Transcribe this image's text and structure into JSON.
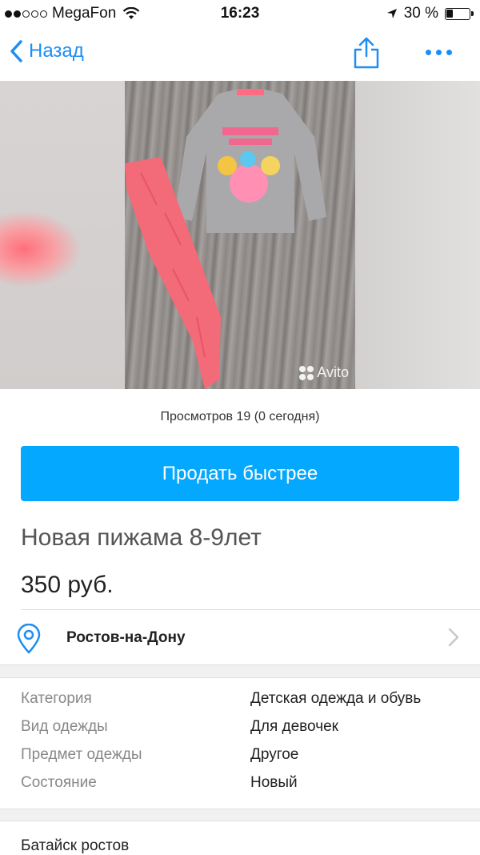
{
  "status_bar": {
    "carrier": "MegaFon",
    "time": "16:23",
    "battery": "30 %",
    "battery_level": 0.3,
    "signal_bars_filled": 2,
    "signal_bars_total": 5
  },
  "nav": {
    "back_label": "Назад",
    "accent_color": "#1c8ef5"
  },
  "gallery": {
    "watermark": "Avito"
  },
  "views": "Просмотров 19 (0 сегодня)",
  "sell_button": {
    "label": "Продать быстрее",
    "color": "#05a8ff"
  },
  "listing": {
    "title": "Новая пижама 8-9лет",
    "price": "350 руб."
  },
  "location": {
    "city": "Ростов-на-Дону"
  },
  "params": [
    {
      "name": "Категория",
      "value": "Детская одежда и обувь"
    },
    {
      "name": "Вид одежды",
      "value": "Для девочек"
    },
    {
      "name": "Предмет одежды",
      "value": "Другое"
    },
    {
      "name": "Состояние",
      "value": "Новый"
    }
  ],
  "address_partial": "Батайск ростов"
}
